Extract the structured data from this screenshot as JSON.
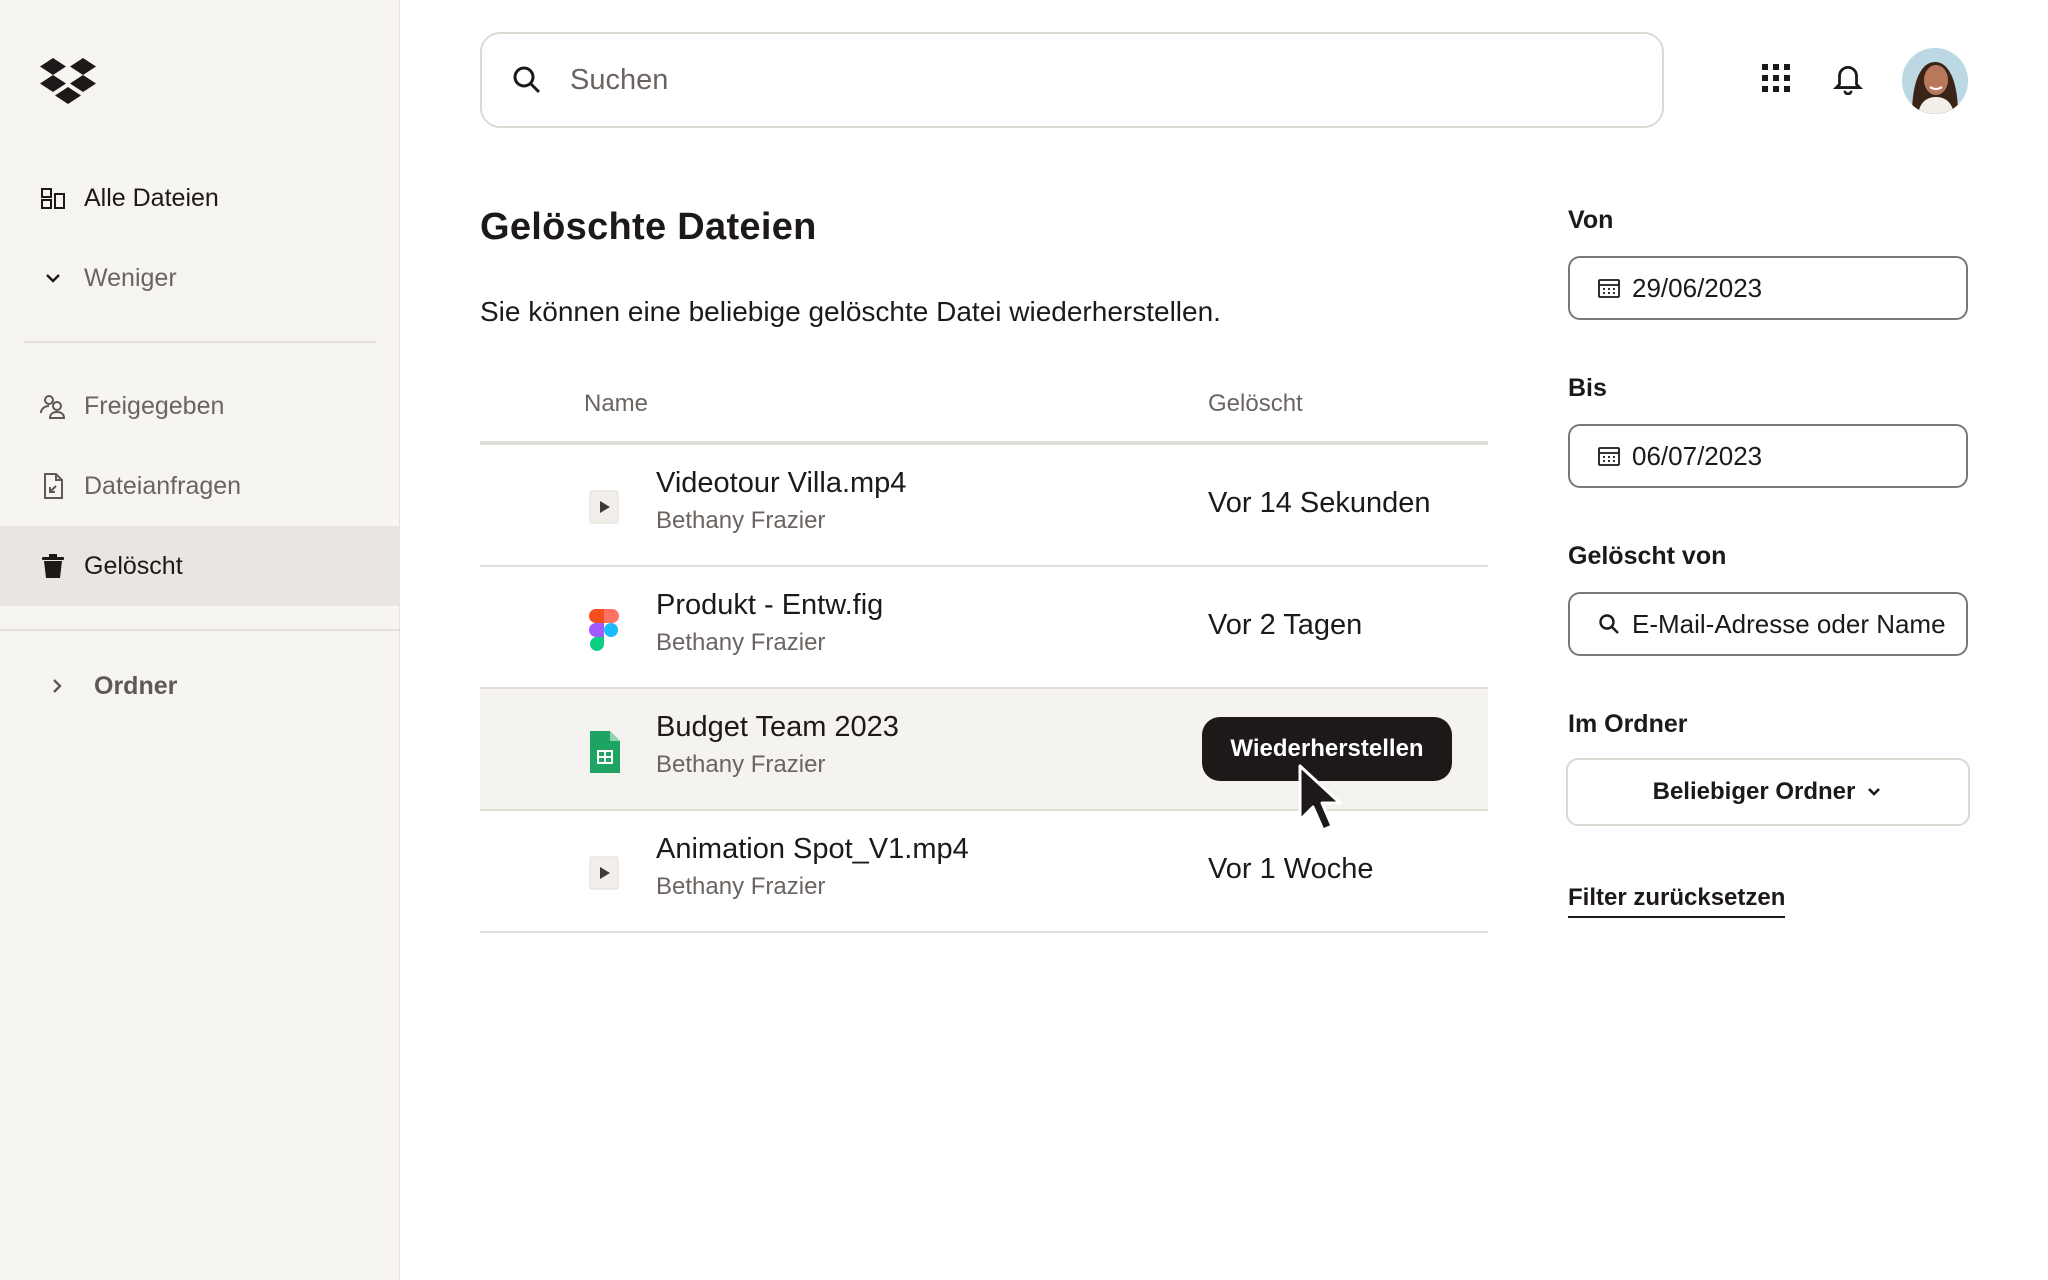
{
  "sidebar": {
    "logo": "dropbox-logo",
    "items": [
      {
        "label": "Alle Dateien",
        "icon": "all-files-icon"
      },
      {
        "label": "Weniger",
        "icon": "chevron-down-icon"
      },
      {
        "label": "Freigegeben",
        "icon": "shared-icon"
      },
      {
        "label": "Dateianfragen",
        "icon": "file-request-icon"
      },
      {
        "label": "Gelöscht",
        "icon": "trash-icon",
        "active": true
      }
    ],
    "folders": {
      "label": "Ordner",
      "icon": "chevron-right-icon"
    }
  },
  "topbar": {
    "search_placeholder": "Suchen",
    "icons": [
      "apps-grid-icon",
      "bell-icon",
      "avatar"
    ]
  },
  "main": {
    "title": "Gelöschte Dateien",
    "description": "Sie können eine beliebige gelöschte Datei wiederherstellen.",
    "columns": {
      "name": "Name",
      "deleted": "Gelöscht"
    },
    "rows": [
      {
        "name": "Videotour Villa.mp4",
        "owner": "Bethany Frazier",
        "deleted": "Vor 14 Sekunden",
        "icon": "video-file-icon"
      },
      {
        "name": "Produkt - Entw.fig",
        "owner": "Bethany Frazier",
        "deleted": "Vor 2 Tagen",
        "icon": "figma-file-icon"
      },
      {
        "name": "Budget Team 2023",
        "owner": "Bethany Frazier",
        "deleted": "",
        "icon": "spreadsheet-file-icon",
        "action": "Wiederherstellen"
      },
      {
        "name": "Animation Spot_V1.mp4",
        "owner": "Bethany Frazier",
        "deleted": "Vor 1 Woche",
        "icon": "video-file-icon"
      }
    ]
  },
  "filters": {
    "from": {
      "label": "Von",
      "value": "29/06/2023"
    },
    "to": {
      "label": "Bis",
      "value": "06/07/2023"
    },
    "deleted_by": {
      "label": "Gelöscht von",
      "placeholder": "E-Mail-Adresse oder Name"
    },
    "folder": {
      "label": "Im Ordner",
      "value": "Beliebiger Ordner"
    },
    "reset": "Filter zurücksetzen"
  },
  "colors": {
    "sidebar_bg": "#f7f5f2",
    "active_item_bg": "#e9e6e1",
    "text": "#1e1919",
    "muted_text": "#6b6461",
    "button_bg": "#1e1919",
    "figma_red": "#f24e1e",
    "figma_purple": "#a259ff",
    "figma_blue": "#1abcfe",
    "figma_green": "#0acf83",
    "sheets_green": "#1ea362"
  }
}
